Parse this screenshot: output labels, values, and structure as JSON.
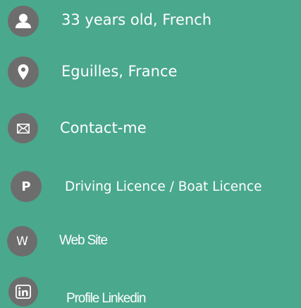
{
  "info": {
    "age": {
      "icon": "person-icon",
      "text": "33 years old, French"
    },
    "location": {
      "icon": "map-pin-icon",
      "text": "Eguilles, France"
    },
    "contact": {
      "icon": "envelope-icon",
      "text": "Contact-me"
    },
    "licence": {
      "icon": "parking-p-icon",
      "icon_glyph": "P",
      "text": "Driving Licence / Boat Licence"
    },
    "website": {
      "icon": "web-w-icon",
      "icon_glyph": "W",
      "text": "Web Site"
    },
    "linkedin": {
      "icon": "linkedin-icon",
      "icon_glyph": "in",
      "text": "Profile Linkedin"
    }
  },
  "colors": {
    "background": "#4aa88c",
    "icon_circle": "#6d6d6d",
    "text": "#ffffff"
  }
}
